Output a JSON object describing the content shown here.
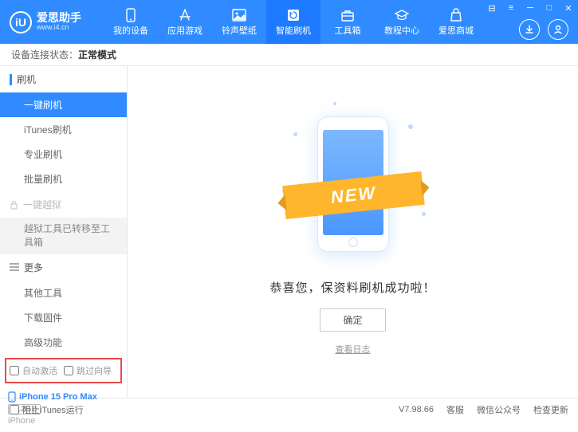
{
  "logo": {
    "glyph": "iU",
    "name": "爱思助手",
    "url": "www.i4.cn"
  },
  "nav": [
    {
      "label": "我的设备"
    },
    {
      "label": "应用游戏"
    },
    {
      "label": "铃声壁纸"
    },
    {
      "label": "智能刷机"
    },
    {
      "label": "工具箱"
    },
    {
      "label": "教程中心"
    },
    {
      "label": "爱思商城"
    }
  ],
  "status": {
    "label": "设备连接状态：",
    "mode": "正常模式"
  },
  "sidebar": {
    "section1": {
      "title": "刷机"
    },
    "items1": [
      "一键刷机",
      "iTunes刷机",
      "专业刷机",
      "批量刷机"
    ],
    "jailbreak": {
      "title": "一键越狱",
      "notice": "越狱工具已转移至工具箱"
    },
    "more": {
      "title": "更多"
    },
    "items_more": [
      "其他工具",
      "下载固件",
      "高级功能"
    ],
    "checkboxes": {
      "auto_activate": "自动激活",
      "skip_guide": "跳过向导"
    },
    "device": {
      "name": "iPhone 15 Pro Max",
      "storage": "512GB",
      "type": "iPhone"
    }
  },
  "main": {
    "ribbon": "NEW",
    "success": "恭喜您，保资料刷机成功啦！",
    "ok": "确定",
    "log": "查看日志"
  },
  "footer": {
    "block_itunes": "阻止iTunes运行",
    "version": "V7.98.66",
    "links": [
      "客服",
      "微信公众号",
      "检查更新"
    ]
  }
}
